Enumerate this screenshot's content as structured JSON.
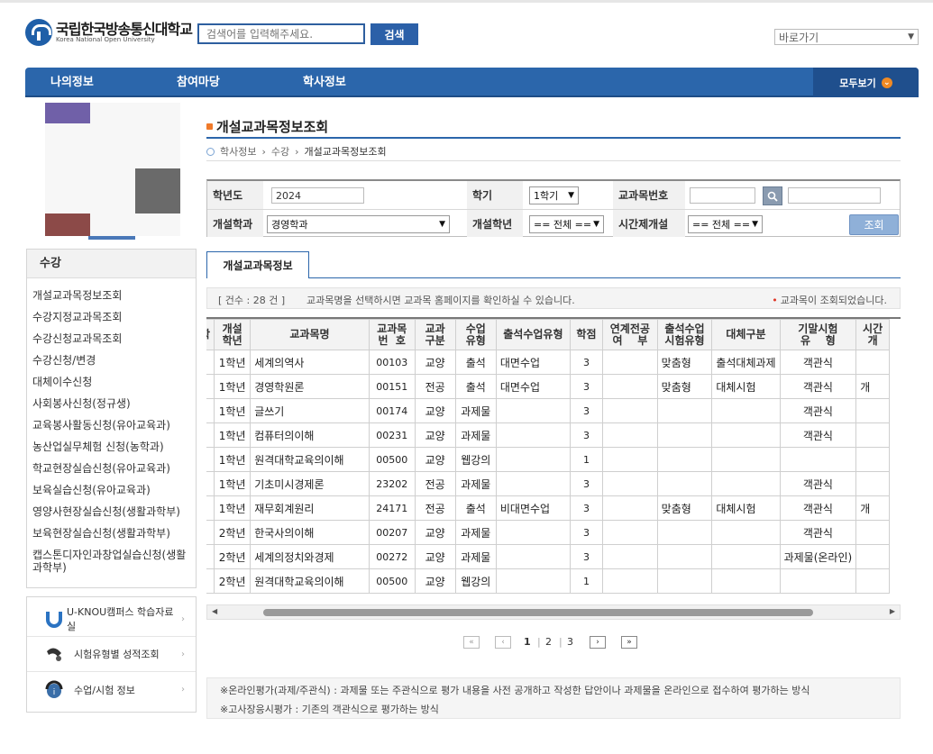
{
  "header": {
    "logo_kr": "국립한국방송통신대학교",
    "logo_en": "Korea National Open University",
    "search_placeholder": "검색어를 입력해주세요.",
    "search_button": "검색",
    "quick_link": "바로가기"
  },
  "nav": {
    "items": [
      "나의정보",
      "참여마당",
      "학사정보"
    ],
    "all_button": "모두보기"
  },
  "sidebar": {
    "title": "수강",
    "items": [
      "개설교과목정보조회",
      "수강지정교과목조회",
      "수강신청교과목조회",
      "수강신청/변경",
      "대체이수신청",
      "사회봉사신청(정규생)",
      "교육봉사활동신청(유아교육과)",
      "농산업실무체험 신청(농학과)",
      "학교현장실습신청(유아교육과)",
      "보육실습신청(유아교육과)",
      "영양사현장실습신청(생활과학부)",
      "보육현장실습신청(생활과학부)",
      "캡스톤디자인과창업실습신청(생활과학부)"
    ],
    "links": [
      {
        "label": "U-KNOU캠퍼스 학습자료실",
        "icon": "u-knou-icon"
      },
      {
        "label": "시험유형별 성적조회",
        "icon": "exam-type-icon"
      },
      {
        "label": "수업/시험 정보",
        "icon": "class-info-icon"
      }
    ]
  },
  "main": {
    "title": "개설교과목정보조회",
    "breadcrumb": [
      "학사정보",
      "수강",
      "개설교과목정보조회"
    ],
    "filter": {
      "year_label": "학년도",
      "year_value": "2024",
      "term_label": "학기",
      "term_value": "1학기",
      "course_code_label": "교과목번호",
      "course_code_value": "",
      "course_name_value": "",
      "dept_label": "개설학과",
      "dept_value": "경영학과",
      "grade_label": "개설학년",
      "grade_value": "== 전체 ==",
      "time_label": "시간제개설",
      "time_value": "== 전체 ==",
      "query_button": "조회"
    },
    "tab": "개설교과목정보",
    "info": {
      "count": "[ 건수 : 28 건 ]",
      "message": "교과목명을 선택하시면 교과목 홈페이지를 확인하실 수 있습니다.",
      "status": "교과목이 조회되었습니다."
    },
    "table": {
      "headers": [
        {
          "l1": "학",
          "l2": ""
        },
        {
          "l1": "개설",
          "l2": "학년"
        },
        {
          "l1": "교과목명",
          "l2": ""
        },
        {
          "l1": "교과목",
          "l2": "번  호"
        },
        {
          "l1": "교과",
          "l2": "구분"
        },
        {
          "l1": "수업",
          "l2": "유형"
        },
        {
          "l1": "출석수업유형",
          "l2": ""
        },
        {
          "l1": "학점",
          "l2": ""
        },
        {
          "l1": "연계전공",
          "l2": "여    부"
        },
        {
          "l1": "출석수업",
          "l2": "시험유형"
        },
        {
          "l1": "대체구분",
          "l2": ""
        },
        {
          "l1": "기말시험",
          "l2": "유    형"
        },
        {
          "l1": "시간",
          "l2": "개"
        }
      ],
      "rows": [
        [
          "",
          "1학년",
          "세계의역사",
          "00103",
          "교양",
          "출석",
          "대면수업",
          "3",
          "",
          "맞춤형",
          "출석대체과제",
          "객관식",
          ""
        ],
        [
          "",
          "1학년",
          "경영학원론",
          "00151",
          "전공",
          "출석",
          "대면수업",
          "3",
          "",
          "맞춤형",
          "대체시험",
          "객관식",
          "개"
        ],
        [
          "",
          "1학년",
          "글쓰기",
          "00174",
          "교양",
          "과제물",
          "",
          "3",
          "",
          "",
          "",
          "객관식",
          ""
        ],
        [
          "",
          "1학년",
          "컴퓨터의이해",
          "00231",
          "교양",
          "과제물",
          "",
          "3",
          "",
          "",
          "",
          "객관식",
          ""
        ],
        [
          "",
          "1학년",
          "원격대학교육의이해",
          "00500",
          "교양",
          "웹강의",
          "",
          "1",
          "",
          "",
          "",
          "",
          ""
        ],
        [
          "",
          "1학년",
          "기초미시경제론",
          "23202",
          "전공",
          "과제물",
          "",
          "3",
          "",
          "",
          "",
          "객관식",
          ""
        ],
        [
          "",
          "1학년",
          "재무회계원리",
          "24171",
          "전공",
          "출석",
          "비대면수업",
          "3",
          "",
          "맞춤형",
          "대체시험",
          "객관식",
          "개"
        ],
        [
          "",
          "2학년",
          "한국사의이해",
          "00207",
          "교양",
          "과제물",
          "",
          "3",
          "",
          "",
          "",
          "객관식",
          ""
        ],
        [
          "",
          "2학년",
          "세계의정치와경제",
          "00272",
          "교양",
          "과제물",
          "",
          "3",
          "",
          "",
          "",
          "과제물(온라인)",
          ""
        ],
        [
          "",
          "2학년",
          "원격대학교육의이해",
          "00500",
          "교양",
          "웹강의",
          "",
          "1",
          "",
          "",
          "",
          "",
          ""
        ]
      ]
    },
    "pager": {
      "pages": [
        "1",
        "2",
        "3"
      ],
      "current": "1"
    },
    "notes": [
      "※온라인평가(과제/주관식) : 과제물 또는 주관식으로 평가 내용을 사전 공개하고 작성한 답안이나 과제물을 온라인으로 접수하여 평가하는 방식",
      "※고사장응시평가 : 기존의 객관식으로 평가하는 방식"
    ]
  },
  "colors": {
    "primary": "#2b66ab",
    "accent": "#f07a2a",
    "status_dot": "#e03a2a"
  }
}
